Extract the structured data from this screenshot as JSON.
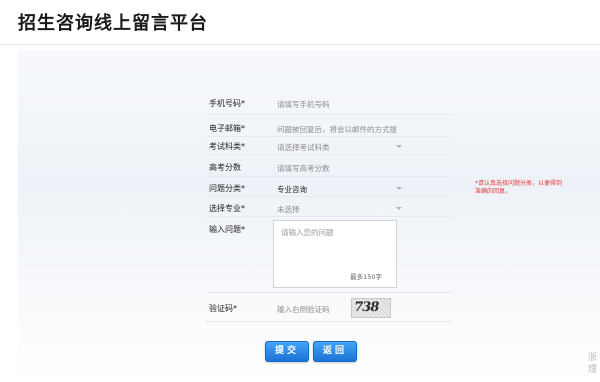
{
  "header": {
    "title": "招生咨询线上留言平台"
  },
  "form": {
    "phone": {
      "label": "手机号码",
      "placeholder": "请填写手机号码"
    },
    "email": {
      "label": "电子邮箱",
      "placeholder": "问题被回复后，将会以邮件的方式提"
    },
    "subject": {
      "label": "考试科类",
      "placeholder": "请选择考试科类"
    },
    "score": {
      "label": "高考分数",
      "placeholder": "请填写高考分数"
    },
    "category": {
      "label": "问题分类",
      "value": "专业咨询"
    },
    "major": {
      "label": "选择专业",
      "value": "未选择"
    },
    "question": {
      "label": "输入问题",
      "placeholder": "请输入您的问题",
      "counter": "最多150字"
    },
    "captcha": {
      "label": "验证码",
      "placeholder": "输入右侧验证码",
      "image_text": "738"
    },
    "required_mark": "*"
  },
  "note": "*请认真选择问题分类，以便得到准确的回复。",
  "buttons": {
    "submit": "提交",
    "back": "返回"
  },
  "corner_text": "浙理"
}
